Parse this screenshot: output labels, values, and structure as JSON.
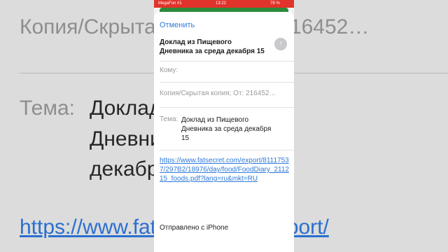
{
  "status_bar": {
    "carrier": "MegaFon #1",
    "time": "13:22",
    "battery": "78 %"
  },
  "compose": {
    "cancel_label": "Отменить",
    "title": "Доклад из Пищевого Дневника за среда декабря 15",
    "send_icon": "arrow-up-icon",
    "to_label": "Кому:",
    "cc_from": "Копия/Скрытая копия; От: 216452…",
    "subject_label": "Тема:",
    "subject_value": "Доклад из Пищевого Дневника за среда декабря 15",
    "body_link": "https://www.fatsecret.com/export/81117537/297B2/18976/day/food/FoodDiary_211215_foods.pdf?lang=ru&mkt=RU",
    "signature": "Отправлено с iPhone"
  },
  "background": {
    "cc_from": "Копия/Скрытая копия; От: 216452…",
    "subject_label": "Тема:",
    "subject_line1": "Доклад из Пищевого",
    "subject_line2": "Дневника за среда",
    "subject_line3": "декабря 15",
    "link": "https://www.fatsecret.com/export/"
  },
  "colors": {
    "status_bar": "#e0332b",
    "accent": "#2f7ad6"
  }
}
